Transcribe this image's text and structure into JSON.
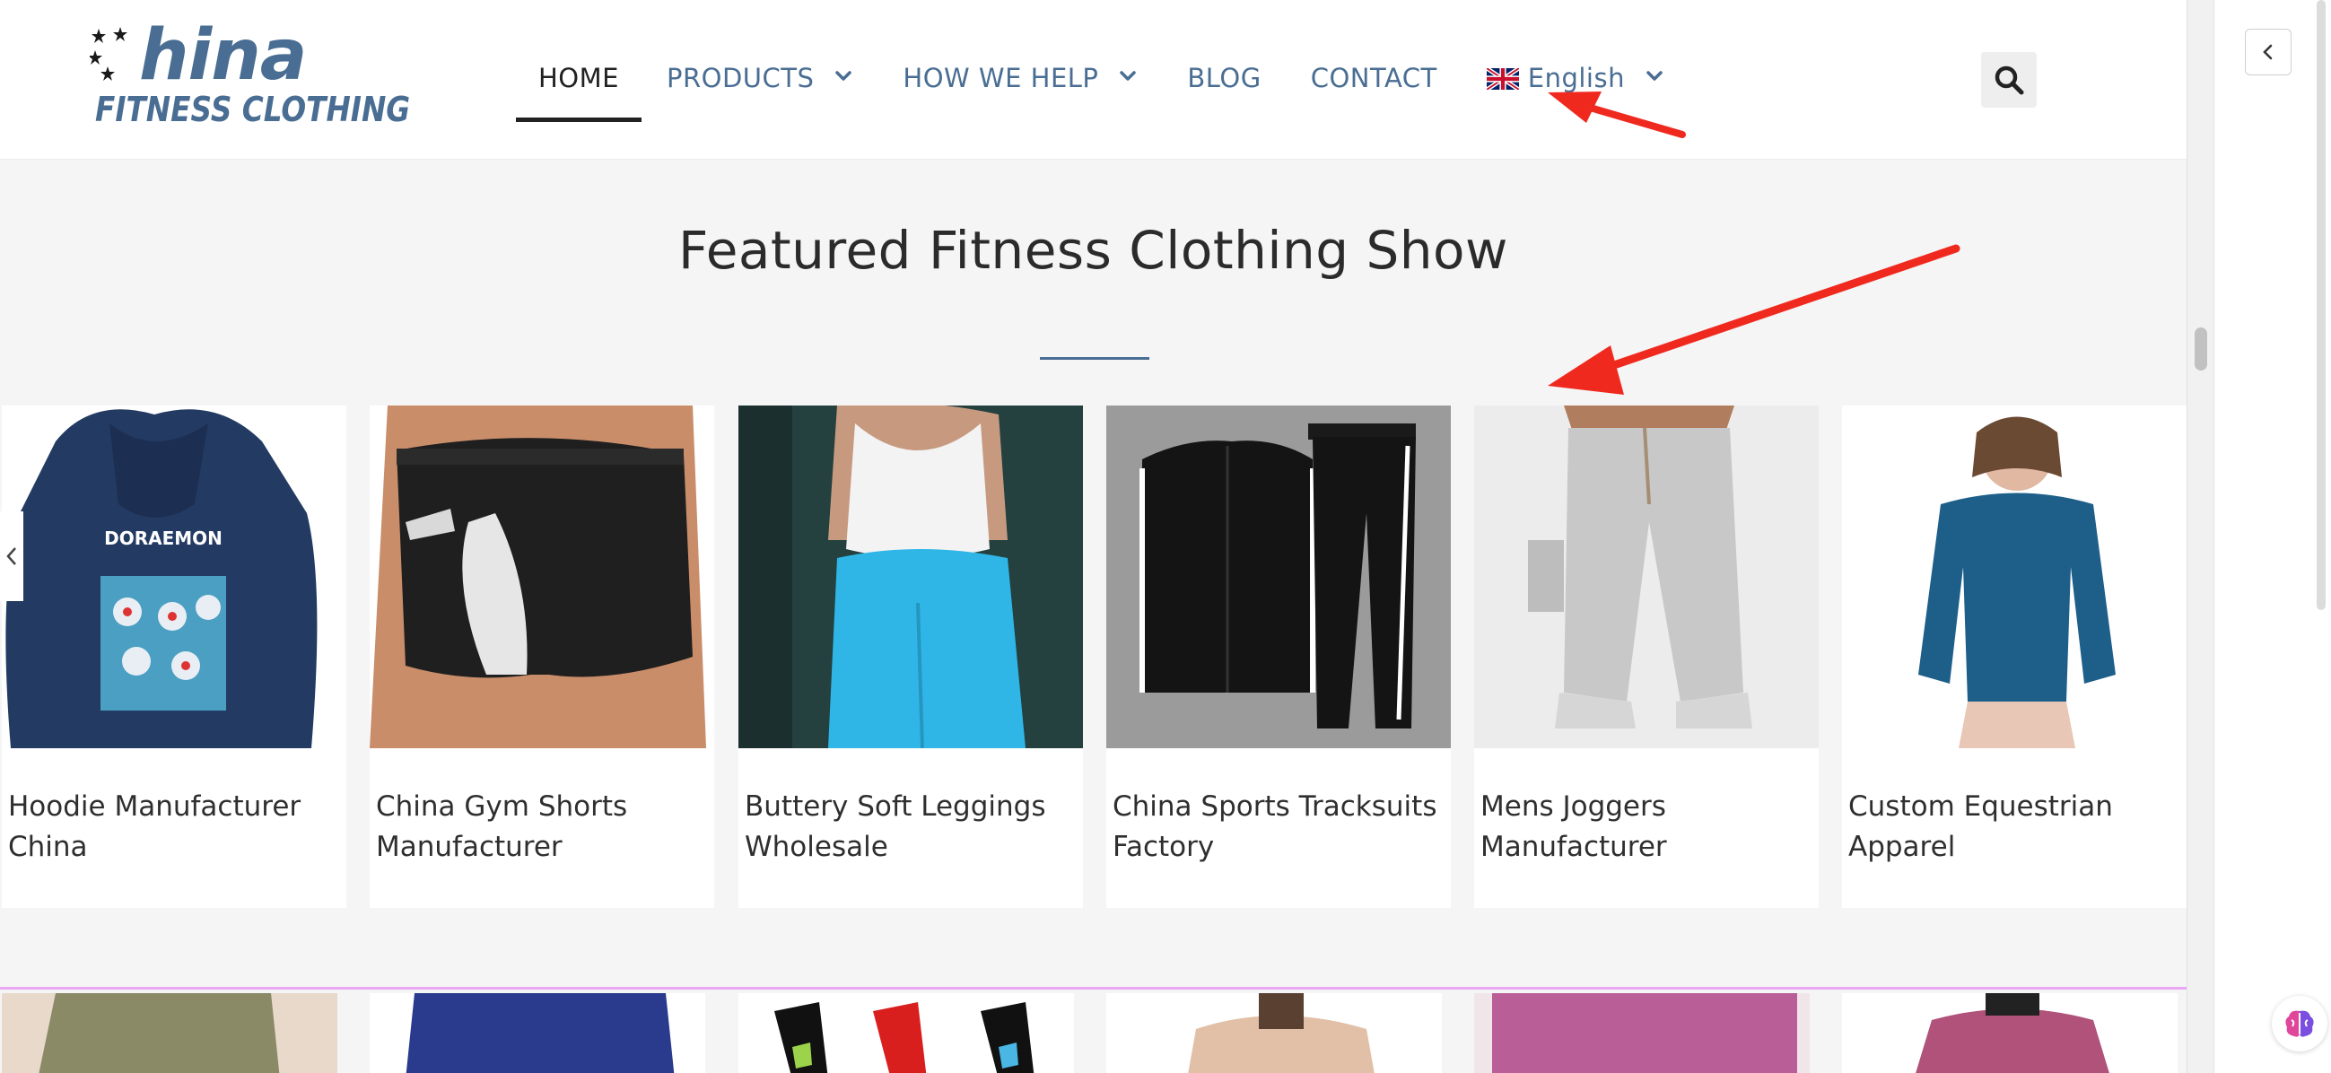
{
  "logo": {
    "top_text": "hina",
    "bottom_text": "FITNESS CLOTHING"
  },
  "nav": {
    "items": [
      {
        "label": "HOME",
        "active": true,
        "dropdown": false
      },
      {
        "label": "PRODUCTS",
        "active": false,
        "dropdown": true
      },
      {
        "label": "HOW WE HELP",
        "active": false,
        "dropdown": true
      },
      {
        "label": "BLOG",
        "active": false,
        "dropdown": false
      },
      {
        "label": "CONTACT",
        "active": false,
        "dropdown": false
      }
    ],
    "language": {
      "label": "English",
      "icon": "uk-flag-icon"
    },
    "search_icon": "search-icon"
  },
  "section": {
    "title": "Featured Fitness Clothing Show"
  },
  "products": [
    {
      "caption": "Hoodie Manufacturer China"
    },
    {
      "caption": "China Gym Shorts Manufacturer"
    },
    {
      "caption": "Buttery Soft Leggings Wholesale"
    },
    {
      "caption": "China Sports Tracksuits Factory"
    },
    {
      "caption": "Mens Joggers Manufacturer"
    },
    {
      "caption": "Custom Equestrian Apparel"
    }
  ],
  "colors": {
    "brand": "#4a6e93",
    "annotation_arrow": "#f0291f",
    "page_bg": "#f5f5f5"
  }
}
